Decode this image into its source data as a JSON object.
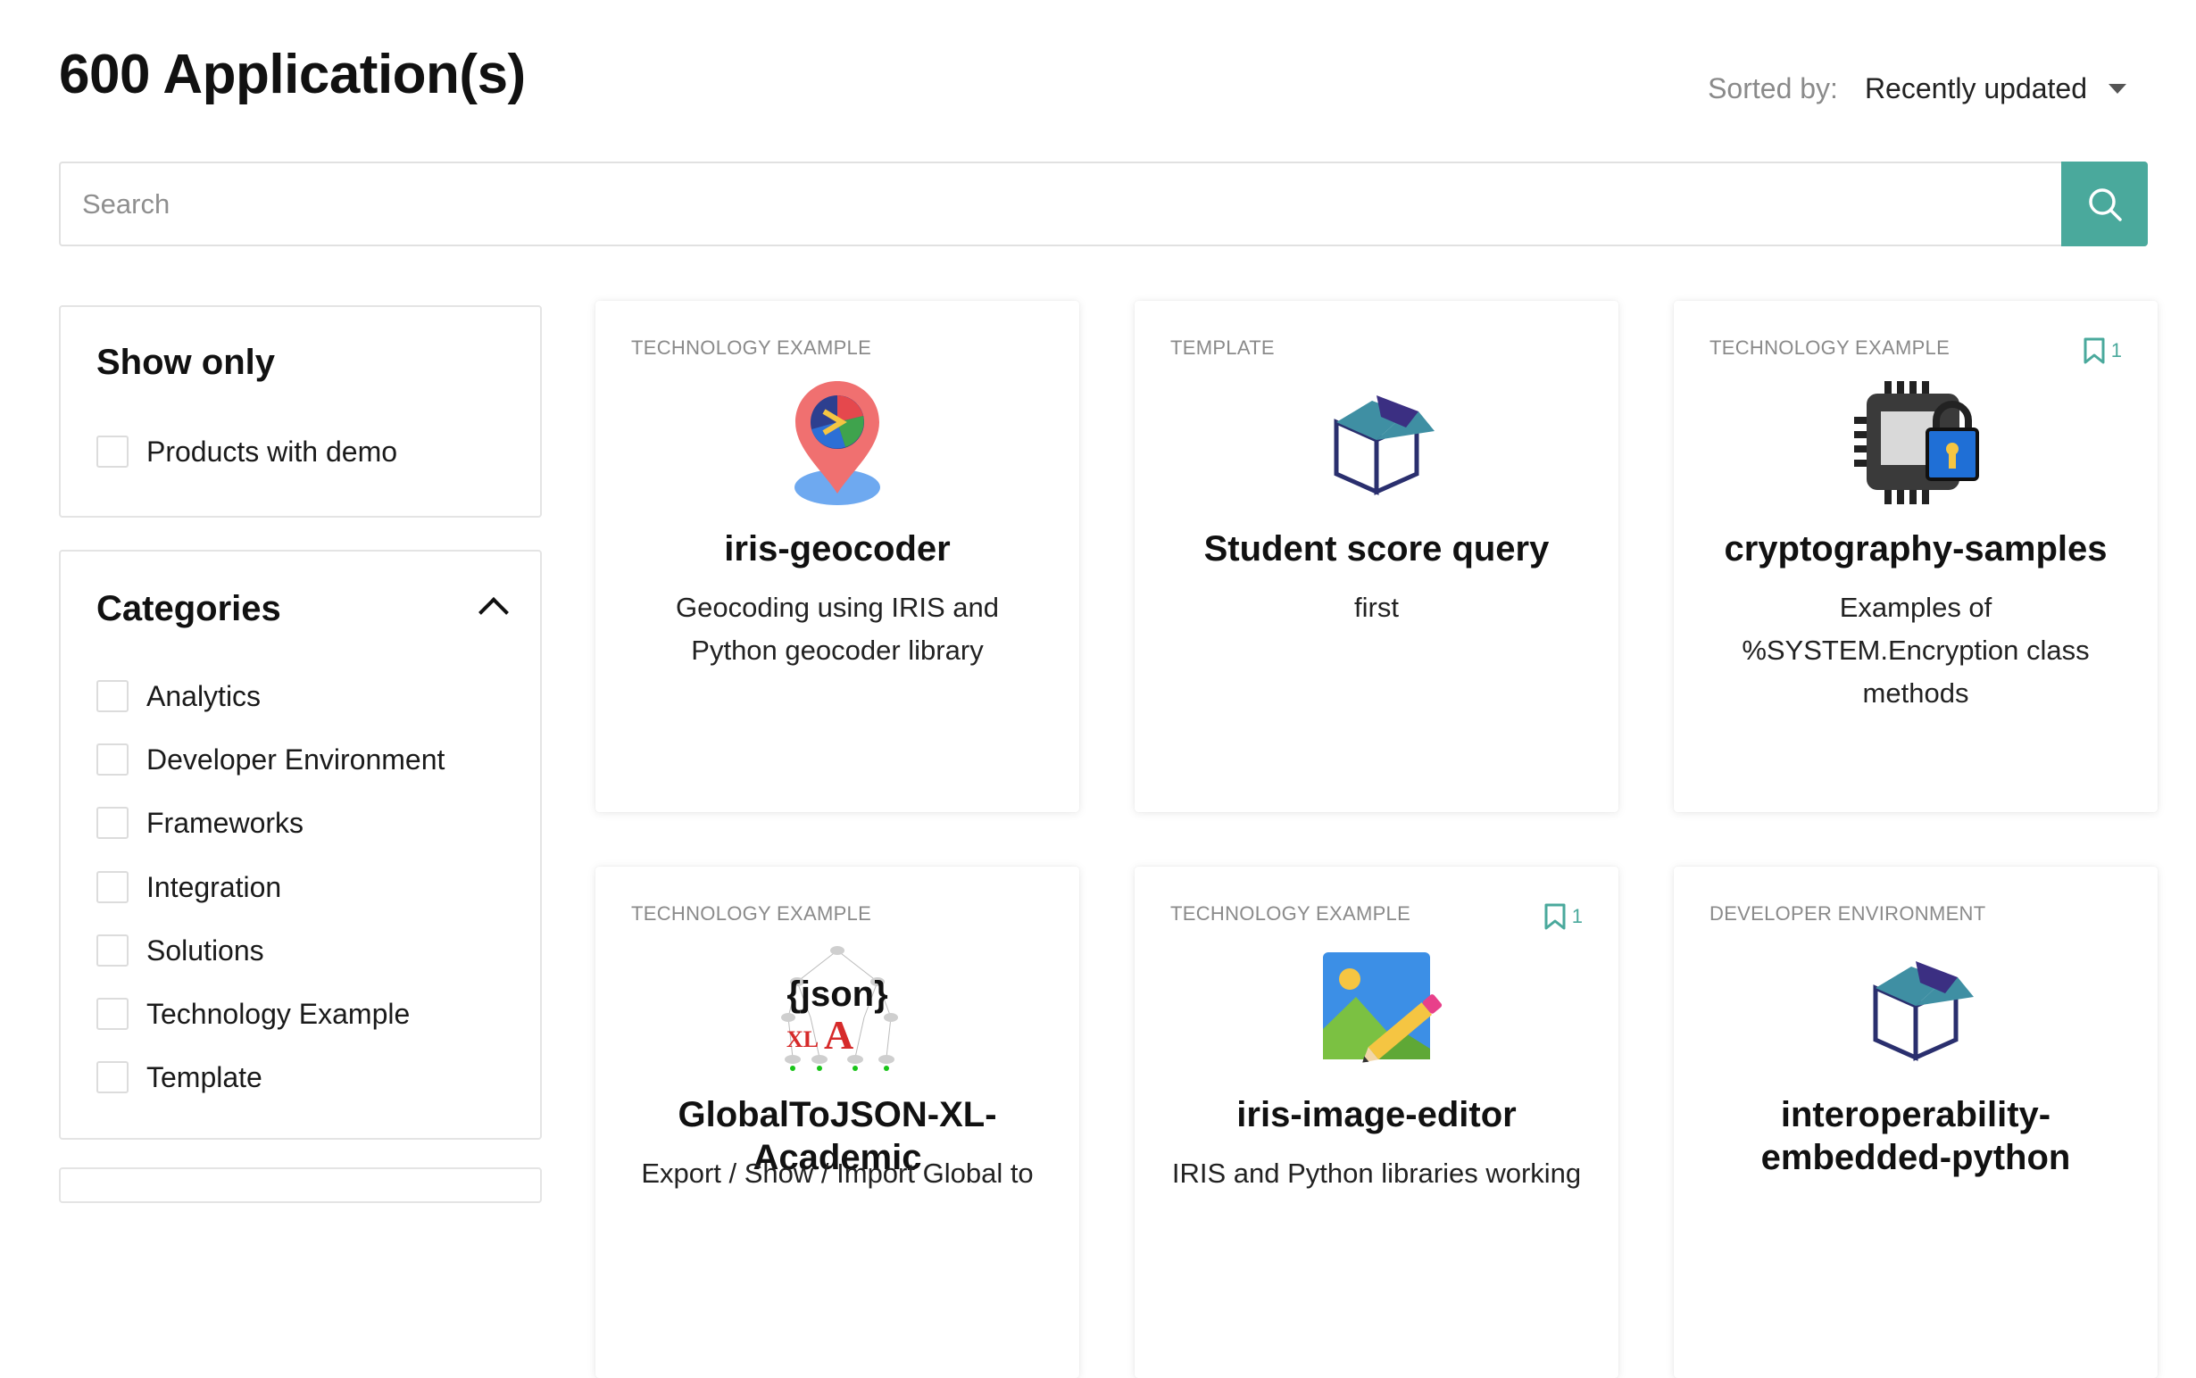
{
  "page_title": "600 Application(s)",
  "sort": {
    "label": "Sorted by:",
    "value": "Recently updated"
  },
  "search": {
    "placeholder": "Search",
    "value": ""
  },
  "colors": {
    "accent": "#4aa99c"
  },
  "show_only": {
    "title": "Show only",
    "options": [
      {
        "label": "Products with demo",
        "checked": false
      }
    ]
  },
  "categories": {
    "title": "Categories",
    "expanded": true,
    "options": [
      {
        "label": "Analytics",
        "checked": false
      },
      {
        "label": "Developer Environment",
        "checked": false
      },
      {
        "label": "Frameworks",
        "checked": false
      },
      {
        "label": "Integration",
        "checked": false
      },
      {
        "label": "Solutions",
        "checked": false
      },
      {
        "label": "Technology Example",
        "checked": false
      },
      {
        "label": "Template",
        "checked": false
      }
    ]
  },
  "apps": [
    {
      "category": "TECHNOLOGY EXAMPLE",
      "name": "iris-geocoder",
      "description": "Geocoding using IRIS and Python geocoder library",
      "bookmarks": null,
      "icon": "map-pin-icon"
    },
    {
      "category": "TEMPLATE",
      "name": "Student score query",
      "description": "first",
      "bookmarks": null,
      "icon": "box-icon"
    },
    {
      "category": "TECHNOLOGY EXAMPLE",
      "name": "cryptography-samples",
      "description": "Examples of %SYSTEM.Encryption class methods",
      "bookmarks": "1",
      "icon": "chip-lock-icon"
    },
    {
      "category": "TECHNOLOGY EXAMPLE",
      "name": "GlobalToJSON-XL-Academic",
      "description": "Export / Show / Import Global to",
      "bookmarks": null,
      "icon": "json-xl-icon"
    },
    {
      "category": "TECHNOLOGY EXAMPLE",
      "name": "iris-image-editor",
      "description": "IRIS and Python libraries working",
      "bookmarks": "1",
      "icon": "image-edit-icon"
    },
    {
      "category": "DEVELOPER ENVIRONMENT",
      "name": "interoperability-embedded-python",
      "description": "",
      "bookmarks": null,
      "icon": "box-icon"
    }
  ]
}
